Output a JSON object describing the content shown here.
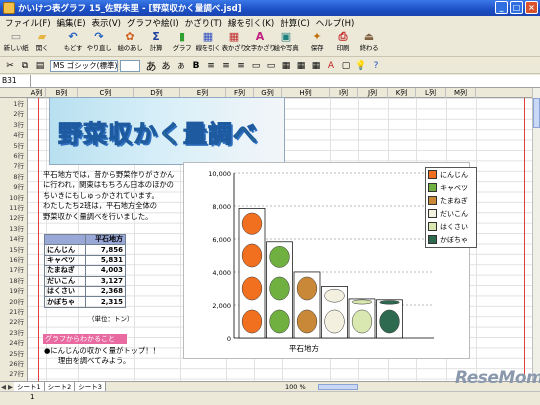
{
  "window": {
    "title": "かいけつ表グラフ 15_佐野朱里 - [野菜収かく量調べ.jsd]"
  },
  "menu": [
    "ファイル(F)",
    "編集(E)",
    "表示(V)",
    "グラフや絵(I)",
    "かざり(T)",
    "線を引く(K)",
    "計算(C)",
    "ヘルプ(H)"
  ],
  "toolbar": [
    {
      "label": "新しい紙",
      "icon": "new-sheet-icon",
      "glyph": "▭",
      "color": "#ffffff"
    },
    {
      "label": "開く",
      "icon": "open-icon",
      "glyph": "▰",
      "color": "#e6b640"
    },
    {
      "label": "もどす",
      "icon": "undo-icon",
      "glyph": "↶",
      "color": "#2060c0"
    },
    {
      "label": "やり直し",
      "icon": "redo-icon",
      "glyph": "↷",
      "color": "#2060c0"
    },
    {
      "label": "絵のあし",
      "icon": "picture-icon",
      "glyph": "✿",
      "color": "#d06020"
    },
    {
      "label": "計算",
      "icon": "sum-icon",
      "glyph": "Σ",
      "color": "#2040a0"
    },
    {
      "label": "グラフ",
      "icon": "graph-icon",
      "glyph": "▮",
      "color": "#30a030"
    },
    {
      "label": "線を引く",
      "icon": "line-icon",
      "glyph": "▦",
      "color": "#3050c0"
    },
    {
      "label": "表かざり",
      "icon": "table-deco-icon",
      "glyph": "▦",
      "color": "#c03030"
    },
    {
      "label": "文字かざり",
      "icon": "text-deco-icon",
      "glyph": "A",
      "color": "#c02080"
    },
    {
      "label": "絵や写真",
      "icon": "photo-icon",
      "glyph": "▣",
      "color": "#208080"
    },
    {
      "label": "保存",
      "icon": "save-icon",
      "glyph": "✦",
      "color": "#c07010"
    },
    {
      "label": "印刷",
      "icon": "print-icon",
      "glyph": "⎙",
      "color": "#c02020"
    },
    {
      "label": "終わる",
      "icon": "exit-icon",
      "glyph": "⏏",
      "color": "#806040"
    }
  ],
  "format": {
    "font": "MS ゴシック(標準)"
  },
  "cellref": "B31",
  "columns": [
    "A列",
    "B列",
    "C列",
    "D列",
    "E列",
    "F列",
    "G列",
    "H列",
    "I列",
    "J列",
    "K列",
    "L列",
    "M列"
  ],
  "rows": [
    "1行",
    "2行",
    "3行",
    "4行",
    "5行",
    "6行",
    "7行",
    "8行",
    "9行",
    "10行",
    "11行",
    "12行",
    "13行",
    "14行",
    "15行",
    "16行",
    "17行",
    "18行",
    "19行",
    "20行",
    "21行",
    "22行",
    "23行",
    "24行",
    "25行",
    "26行",
    "27行"
  ],
  "banner": "野菜収かく量調べ",
  "paragraph": [
    "平石地方では，昔から野菜作りがさかん",
    "に行われ，関東はもちろん日本のほかの",
    "ちいきにもしゅっかされています。",
    "わたしたち2班は，平石地方全体の",
    "野菜収かく量調べを行いました。"
  ],
  "table": {
    "header": "平石地方",
    "rows": [
      {
        "name": "にんじん",
        "value": "7,856"
      },
      {
        "name": "キャベツ",
        "value": "5,831"
      },
      {
        "name": "たまねぎ",
        "value": "4,003"
      },
      {
        "name": "だいこん",
        "value": "3,127"
      },
      {
        "name": "はくさい",
        "value": "2,368"
      },
      {
        "name": "かぼちゃ",
        "value": "2,315"
      }
    ],
    "unit": "（単位：トン）"
  },
  "notes": {
    "heading": "グラフからわかること",
    "line1": "●にんじんの収かく量がトップ！！",
    "line2": "理由を調べてみよう。"
  },
  "chart_data": {
    "type": "bar",
    "categories": [
      "平石地方"
    ],
    "series": [
      {
        "name": "にんじん",
        "values": [
          7856
        ],
        "color": "#f07020"
      },
      {
        "name": "キャベツ",
        "values": [
          5831
        ],
        "color": "#70b040"
      },
      {
        "name": "たまねぎ",
        "values": [
          4003
        ],
        "color": "#c88838"
      },
      {
        "name": "だいこん",
        "values": [
          3127
        ],
        "color": "#f4f0e0"
      },
      {
        "name": "はくさい",
        "values": [
          2368
        ],
        "color": "#d8e8b0"
      },
      {
        "name": "かぼちゃ",
        "values": [
          2315
        ],
        "color": "#2e6a50"
      }
    ],
    "yticks": [
      "0",
      "2,000",
      "4,000",
      "6,000",
      "8,000",
      "10,000"
    ],
    "ylim": [
      0,
      10000
    ],
    "xlabel": "平石地方",
    "grid": true,
    "legend": "right"
  },
  "tabs": {
    "sheets": [
      "シート1",
      "シート2",
      "シート3"
    ],
    "zoom": "100 %"
  },
  "status": "1",
  "watermark": "ReseMom"
}
